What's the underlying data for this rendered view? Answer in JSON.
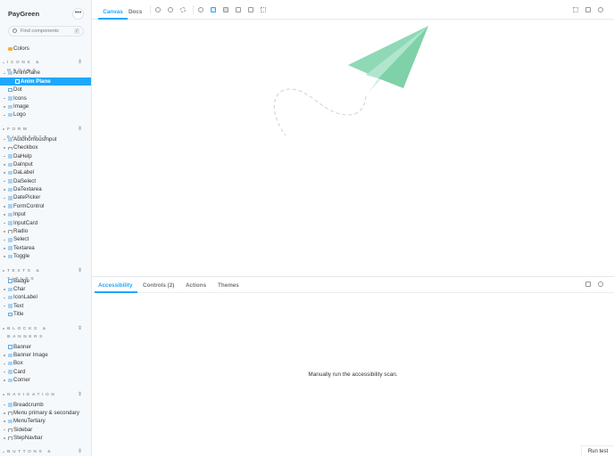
{
  "sidebar": {
    "brand": "PayGreen",
    "menu_label": "•••",
    "search_placeholder": "Find components",
    "search_shortcut": "/",
    "tree": [
      {
        "type": "item",
        "label": "Colors",
        "icon": "doc"
      },
      {
        "type": "header",
        "label": "ICONS & MEDIAS"
      },
      {
        "type": "item",
        "label": "AnimPlane",
        "icon": "component"
      },
      {
        "type": "item",
        "label": "Anim Plane",
        "icon": "story",
        "sub": true,
        "selected": true
      },
      {
        "type": "item",
        "label": "Dot",
        "icon": "story"
      },
      {
        "type": "item",
        "label": "Icons",
        "icon": "component"
      },
      {
        "type": "item",
        "label": "Image",
        "icon": "component"
      },
      {
        "type": "item",
        "label": "Logo",
        "icon": "component"
      },
      {
        "type": "header",
        "label": "FORM ELEMENTS"
      },
      {
        "type": "item",
        "label": "AutonomousInput",
        "icon": "component"
      },
      {
        "type": "item",
        "label": "Checkbox",
        "icon": "folder"
      },
      {
        "type": "item",
        "label": "DaHelp",
        "icon": "component"
      },
      {
        "type": "item",
        "label": "DaInput",
        "icon": "component"
      },
      {
        "type": "item",
        "label": "DaLabel",
        "icon": "component"
      },
      {
        "type": "item",
        "label": "DaSelect",
        "icon": "component"
      },
      {
        "type": "item",
        "label": "DaTextarea",
        "icon": "component"
      },
      {
        "type": "item",
        "label": "DatePicker",
        "icon": "component"
      },
      {
        "type": "item",
        "label": "FormControl",
        "icon": "component"
      },
      {
        "type": "item",
        "label": "Input",
        "icon": "component"
      },
      {
        "type": "item",
        "label": "InputCard",
        "icon": "component"
      },
      {
        "type": "item",
        "label": "Radio",
        "icon": "folder"
      },
      {
        "type": "item",
        "label": "Select",
        "icon": "component"
      },
      {
        "type": "item",
        "label": "Textarea",
        "icon": "component"
      },
      {
        "type": "item",
        "label": "Toggle",
        "icon": "component"
      },
      {
        "type": "header",
        "label": "TEXTS & TITLES"
      },
      {
        "type": "item",
        "label": "Badge",
        "icon": "story"
      },
      {
        "type": "item",
        "label": "Char",
        "icon": "component"
      },
      {
        "type": "item",
        "label": "IconLabel",
        "icon": "component"
      },
      {
        "type": "item",
        "label": "Text",
        "icon": "component"
      },
      {
        "type": "item",
        "label": "Title",
        "icon": "story"
      },
      {
        "type": "header",
        "label": "BLOCKS & BANNERS",
        "two": true
      },
      {
        "type": "item",
        "label": "Banner",
        "icon": "story"
      },
      {
        "type": "item",
        "label": "Banner Image",
        "icon": "component"
      },
      {
        "type": "item",
        "label": "Box",
        "icon": "component"
      },
      {
        "type": "item",
        "label": "Card",
        "icon": "component"
      },
      {
        "type": "item",
        "label": "Corner",
        "icon": "component"
      },
      {
        "type": "header",
        "label": "NAVIGATION"
      },
      {
        "type": "item",
        "label": "Breadcrumb",
        "icon": "component"
      },
      {
        "type": "item",
        "label": "Menu primary & secondary",
        "icon": "folder"
      },
      {
        "type": "item",
        "label": "MenuTertiary",
        "icon": "component"
      },
      {
        "type": "item",
        "label": "Sidebar",
        "icon": "folder"
      },
      {
        "type": "item",
        "label": "StepNavbar",
        "icon": "folder"
      },
      {
        "type": "header",
        "label": "BUTTONS &"
      }
    ]
  },
  "toolbar": {
    "tabs": [
      "Canvas",
      "Docs"
    ],
    "active_tab": "Canvas"
  },
  "panel": {
    "tabs": [
      "Accessibility",
      "Controls (2)",
      "Actions",
      "Themes"
    ],
    "active_tab": "Accessibility",
    "message": "Manually run the accessibility scan.",
    "run_button": "Run test"
  },
  "colors": {
    "accent": "#1ea7fd",
    "plane": "#8fd9b6"
  }
}
